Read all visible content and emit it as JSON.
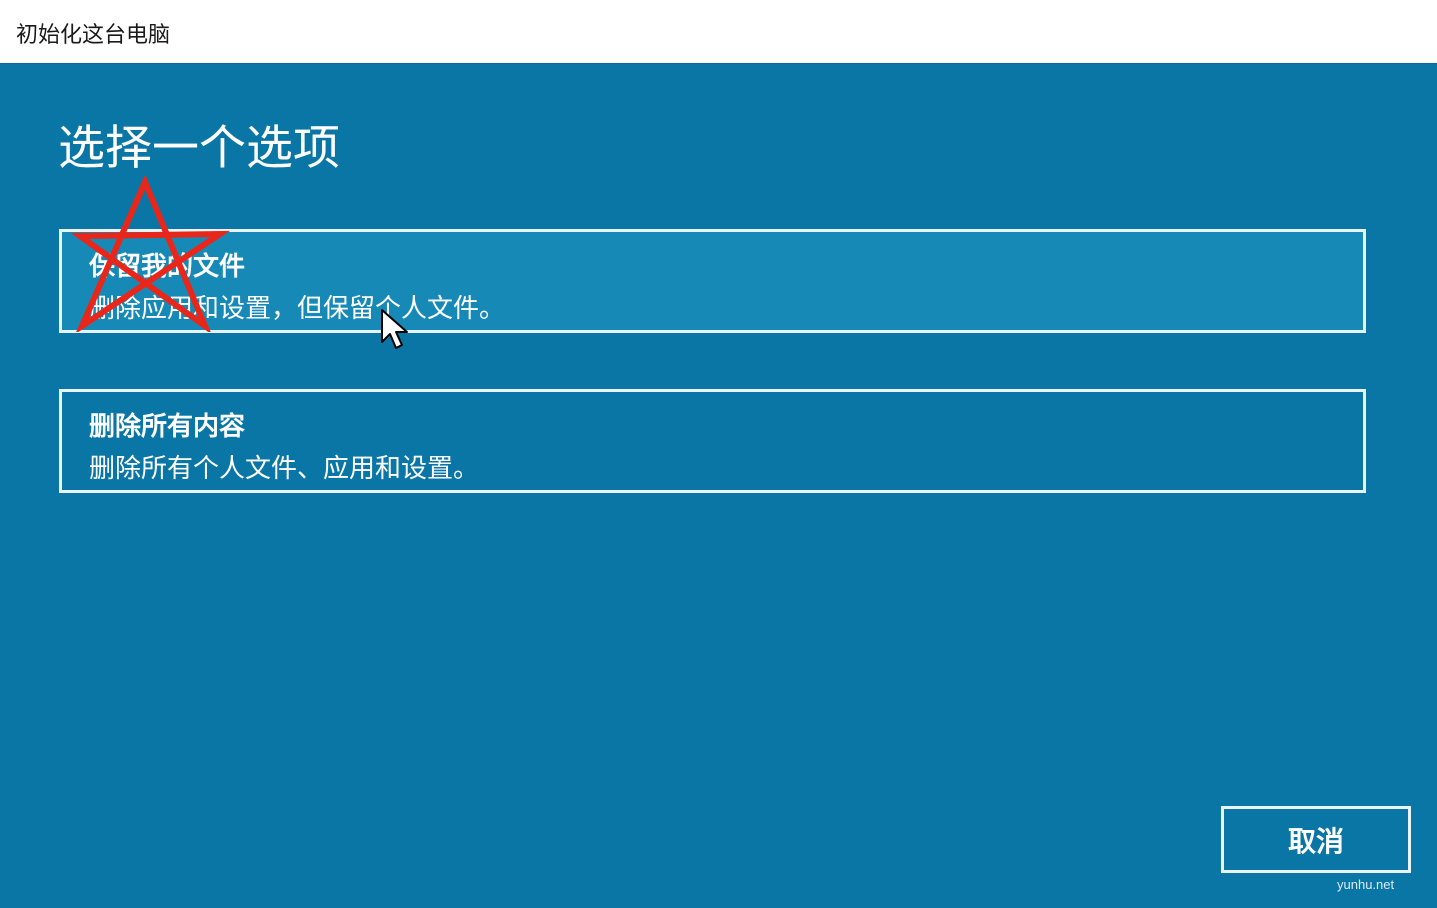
{
  "window": {
    "title": "初始化这台电脑"
  },
  "main": {
    "heading": "选择一个选项",
    "options": [
      {
        "title": "保留我的文件",
        "description": "删除应用和设置，但保留个人文件。"
      },
      {
        "title": "删除所有内容",
        "description": "删除所有个人文件、应用和设置。"
      }
    ]
  },
  "footer": {
    "cancel_label": "取消"
  },
  "watermark": "yunhu.net",
  "annotation": {
    "shape": "star-outline",
    "color": "#e8271a"
  },
  "cursor": {
    "icon": "mouse-pointer-icon"
  },
  "colors": {
    "background": "#0a76a6",
    "option_hover": "#1789b6",
    "border": "#e9f4f9",
    "titlebar": "#ffffff"
  }
}
